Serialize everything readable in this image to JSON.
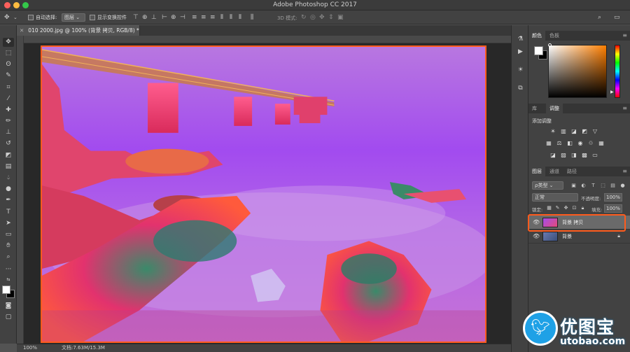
{
  "window": {
    "title": "Adobe Photoshop CC 2017"
  },
  "options_bar": {
    "auto_select_label": "自动选择:",
    "auto_select_value": "图层",
    "show_transform_label": "显示变换控件",
    "mode_label": "3D 模式:"
  },
  "document_tab": {
    "title": "010 2000.jpg @ 100% (背景 拷贝, RGB/8) *"
  },
  "status_bar": {
    "zoom": "100%",
    "doc_size": "文档:7.63M/15.3M"
  },
  "color_panel": {
    "tabs": [
      "颜色",
      "色板"
    ],
    "foreground": "#ffffff",
    "background": "#000000",
    "picked_hue": "#ff7f00"
  },
  "adjustments_panel": {
    "tabs": [
      "库",
      "调整"
    ],
    "add_label": "添加调整"
  },
  "layers_panel": {
    "tabs": [
      "图层",
      "通道",
      "路径"
    ],
    "filter_kind": "ρ类型",
    "blend_mode": "正常",
    "opacity_label": "不透明度:",
    "opacity_value": "100%",
    "lock_label": "锁定:",
    "fill_label": "填充:",
    "fill_value": "100%",
    "layers": [
      {
        "name": "背景 拷贝",
        "selected": true,
        "locked": false
      },
      {
        "name": "背景",
        "selected": false,
        "locked": true
      }
    ]
  },
  "watermark": {
    "brand": "优图宝",
    "url": "utobao.com"
  },
  "highlight_color": "#ff5b1d"
}
